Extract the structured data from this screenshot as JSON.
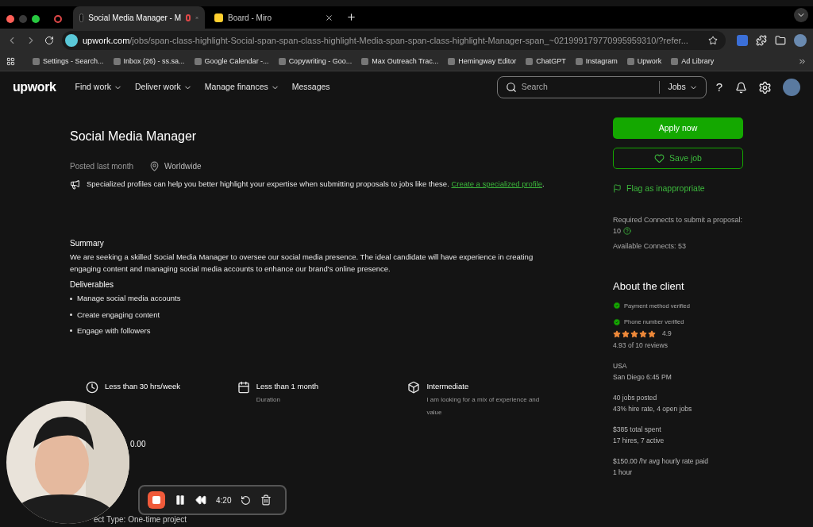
{
  "browser": {
    "tabs": [
      {
        "label": "Social Media Manager - M",
        "selected": true,
        "recording": true
      },
      {
        "label": "Board - Miro",
        "selected": false,
        "recording": false
      }
    ],
    "url": {
      "host": "upwork.com",
      "path": "/jobs/span-class-highlight-Social-span-span-class-highlight-Media-span-span-class-highlight-Manager-span_~021999179770995959310/?refer..."
    },
    "bookmarks": [
      "Settings - Search...",
      "Inbox (26) - ss.sa...",
      "Google Calendar -...",
      "Copywriting - Goo...",
      "Max Outreach Trac...",
      "Hemingway Editor",
      "ChatGPT",
      "Instagram",
      "Upwork",
      "Ad Library"
    ]
  },
  "nav": {
    "logo": "upwork",
    "items": [
      "Find work",
      "Deliver work",
      "Manage finances",
      "Messages"
    ],
    "search": {
      "placeholder": "Search",
      "scope": "Jobs"
    },
    "help": "?"
  },
  "job": {
    "title": "Social Media Manager",
    "posted": "Posted last month",
    "location": "Worldwide",
    "notice": "Specialized profiles can help you better highlight your expertise when submitting proposals to jobs like these.",
    "notice_link": "Create a specialized profile",
    "notice_end": ".",
    "summary_heading": "Summary",
    "summary": "We are seeking a skilled Social Media Manager to oversee our social media presence. The ideal candidate will have experience in creating engaging content and managing social media accounts to enhance our brand's online presence.",
    "deliverables_heading": "Deliverables",
    "deliverables": [
      "Manage social media accounts",
      "Create engaging content",
      "Engage with followers"
    ],
    "features": [
      {
        "kind": "clock",
        "title": "Less than 30 hrs/week"
      },
      {
        "kind": "duration",
        "title": "Less than 1 month",
        "note": "Duration"
      },
      {
        "kind": "level",
        "title": "Intermediate",
        "note": "I am looking for a mix of experience and value"
      }
    ],
    "budget_fragment": "0.00",
    "project_type_fragment": "ect Type: One-time project"
  },
  "sidebar": {
    "apply": "Apply now",
    "save": "Save job",
    "flag": "Flag as inappropriate",
    "connects_required": "Required Connects to submit a proposal: 10",
    "connects_available": "Available Connects: 53",
    "client_heading": "About the client",
    "verifications": [
      {
        "label": "Payment method verified",
        "verified": true
      },
      {
        "label": "Phone number verified",
        "verified": true
      }
    ],
    "stars": 5,
    "rating": "4.9",
    "reviews": "4.93 of 10 reviews",
    "stats": [
      [
        "USA",
        "San Diego 6:45 PM"
      ],
      [
        "40 jobs posted",
        "43% hire rate, 4 open jobs"
      ],
      [
        "$385 total spent",
        "17 hires, 7 active"
      ],
      [
        "$150.00 /hr avg hourly rate paid",
        "1 hour"
      ]
    ]
  },
  "recorder": {
    "time": "4:20"
  }
}
